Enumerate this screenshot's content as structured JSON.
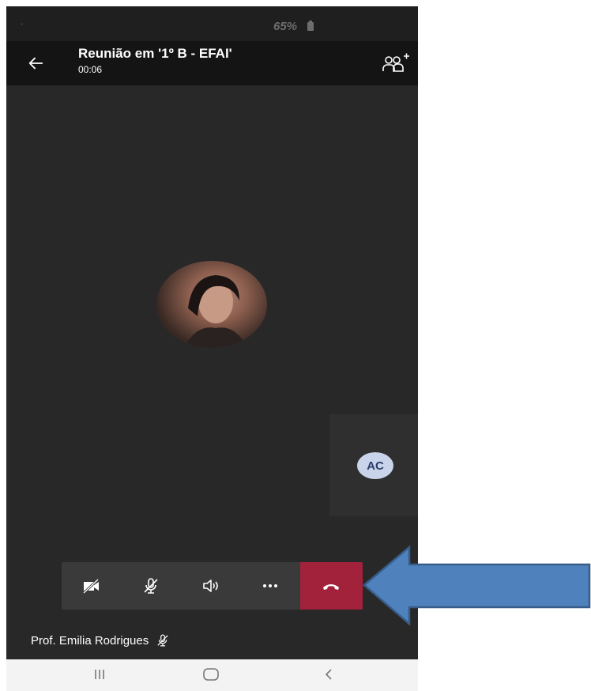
{
  "status_bar": {
    "battery": "65%"
  },
  "header": {
    "title": "Reunião em '1º B - EFAI'",
    "timer": "00:06",
    "back_icon": "arrow-left-icon",
    "participants_icon": "add-participants-icon"
  },
  "participants": {
    "main_avatar": "participant-photo",
    "side_initials": "AC"
  },
  "controls": [
    {
      "name": "camera-off-button",
      "icon": "camera-off-icon"
    },
    {
      "name": "mic-off-button",
      "icon": "mic-off-icon"
    },
    {
      "name": "speaker-button",
      "icon": "speaker-icon"
    },
    {
      "name": "more-options-button",
      "icon": "more-dots-icon"
    },
    {
      "name": "hang-up-button",
      "icon": "phone-hangup-icon",
      "color": "#a3223b"
    }
  ],
  "footer": {
    "participant_name": "Prof. Emilia Rodrigues",
    "participant_icon": "mic-off-icon"
  },
  "nav": [
    "recent-apps-icon",
    "home-icon",
    "back-chevron-icon"
  ],
  "colors": {
    "background": "#282828",
    "header": "#141414",
    "hangup": "#a3223b",
    "annotation_arrow": "#4f81bd"
  }
}
